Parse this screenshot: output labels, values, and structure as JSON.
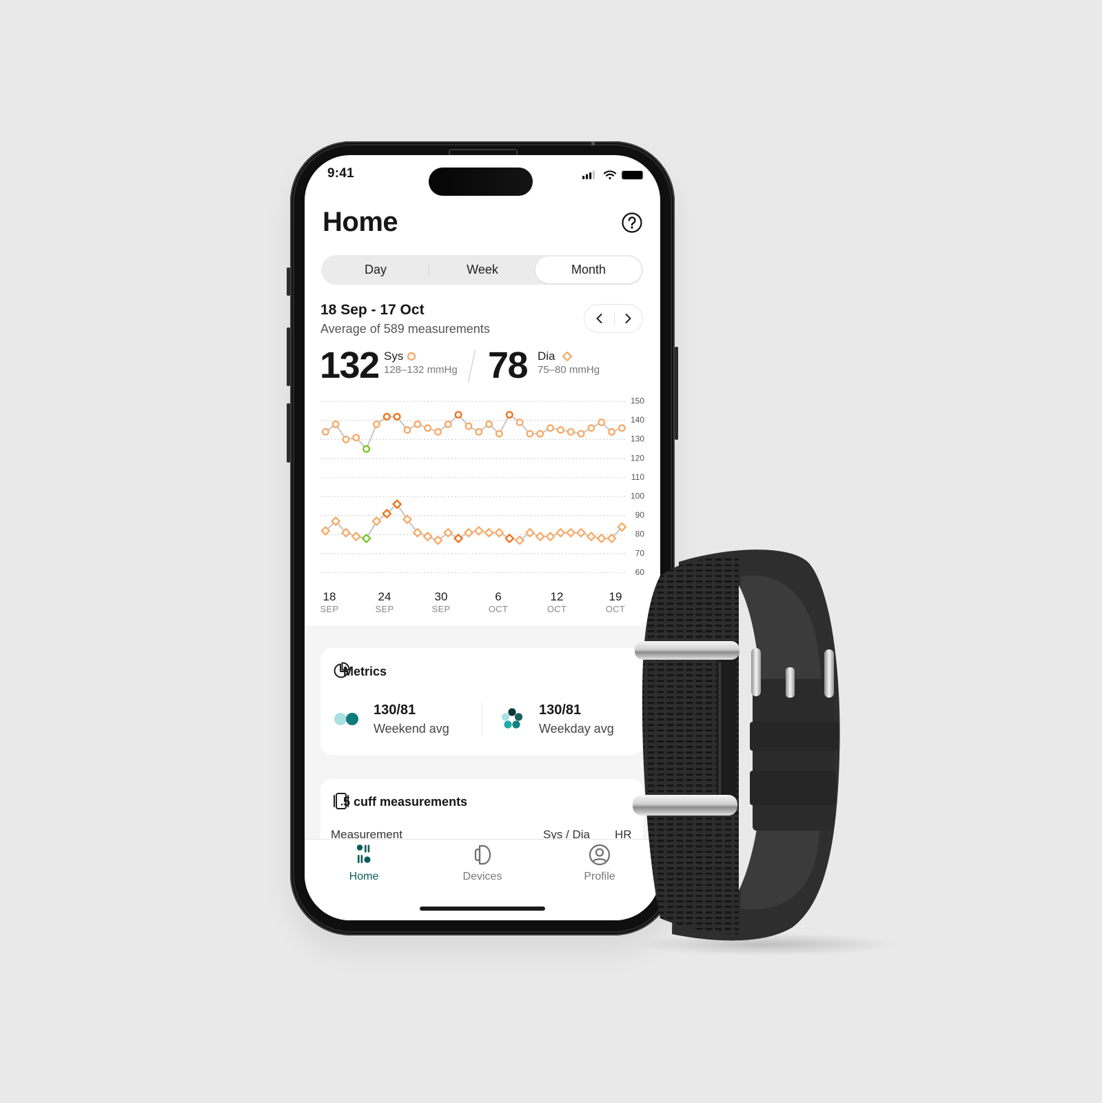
{
  "status_bar": {
    "time": "9:41",
    "icons": [
      "cellular-signal-icon",
      "wifi-icon",
      "battery-icon"
    ]
  },
  "header": {
    "title": "Home",
    "help_icon": "help-circle-icon"
  },
  "period_tabs": [
    {
      "label": "Day",
      "selected": false
    },
    {
      "label": "Week",
      "selected": false
    },
    {
      "label": "Month",
      "selected": true
    }
  ],
  "summary": {
    "date_range": "18 Sep - 17 Oct",
    "subtitle": "Average of 589 measurements",
    "sys": {
      "value": "132",
      "label": "Sys",
      "range": "128–132 mmHg"
    },
    "dia": {
      "value": "78",
      "label": "Dia",
      "range": "75–80 mmHg"
    }
  },
  "chart_data": {
    "type": "line",
    "title": "",
    "xlabel": "",
    "ylabel": "mmHg",
    "ylim": [
      60,
      150
    ],
    "yticks": [
      150,
      140,
      130,
      120,
      110,
      100,
      90,
      80,
      70,
      60
    ],
    "grid": true,
    "x": [
      "18 Sep",
      "19 Sep",
      "20 Sep",
      "21 Sep",
      "22 Sep",
      "23 Sep",
      "24 Sep",
      "25 Sep",
      "26 Sep",
      "27 Sep",
      "28 Sep",
      "29 Sep",
      "30 Sep",
      "1 Oct",
      "2 Oct",
      "3 Oct",
      "4 Oct",
      "5 Oct",
      "6 Oct",
      "7 Oct",
      "8 Oct",
      "9 Oct",
      "10 Oct",
      "11 Oct",
      "12 Oct",
      "13 Oct",
      "14 Oct",
      "15 Oct",
      "16 Oct",
      "17 Oct"
    ],
    "xtick_labels": [
      {
        "day": "18",
        "month": "SEP"
      },
      {
        "day": "24",
        "month": "SEP"
      },
      {
        "day": "30",
        "month": "SEP"
      },
      {
        "day": "6",
        "month": "OCT"
      },
      {
        "day": "12",
        "month": "OCT"
      },
      {
        "day": "19",
        "month": "OCT"
      }
    ],
    "series": [
      {
        "name": "Sys",
        "marker": "circle",
        "values": [
          134,
          138,
          130,
          131,
          125,
          138,
          142,
          142,
          135,
          138,
          136,
          134,
          138,
          143,
          137,
          134,
          138,
          133,
          143,
          139,
          133,
          133,
          136,
          135,
          134,
          133,
          136,
          139,
          134,
          136
        ]
      },
      {
        "name": "Dia",
        "marker": "diamond",
        "values": [
          82,
          87,
          81,
          79,
          78,
          87,
          91,
          96,
          88,
          81,
          79,
          77,
          81,
          78,
          81,
          82,
          81,
          81,
          78,
          77,
          81,
          79,
          79,
          81,
          81,
          81,
          79,
          78,
          78,
          84
        ]
      }
    ],
    "highlights": {
      "high": [
        6,
        7,
        13,
        18
      ],
      "low": [
        4
      ]
    }
  },
  "metrics": {
    "title": "Metrics",
    "items": [
      {
        "value": "130/81",
        "label": "Weekend avg"
      },
      {
        "value": "130/81",
        "label": "Weekday avg"
      }
    ]
  },
  "cuff": {
    "title": "5 cuff measurements",
    "columns": [
      "Measurement",
      "Sys / Dia",
      "HR"
    ]
  },
  "tab_bar": [
    {
      "label": "Home",
      "active": true
    },
    {
      "label": "Devices",
      "active": false
    },
    {
      "label": "Profile",
      "active": false
    }
  ],
  "colors": {
    "accent": "#0d5a5a",
    "marker_normal": "#f9a65e",
    "marker_high": "#f26a0c",
    "marker_low": "#6cc41a",
    "connector": "#c9c9c9",
    "teal_light": "#a9e1e1",
    "teal_dark": "#0f7b7b"
  }
}
